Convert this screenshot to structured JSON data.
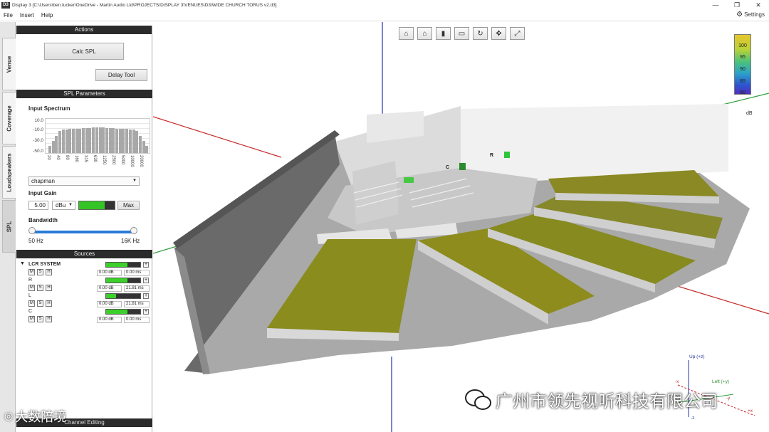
{
  "window": {
    "icon_label": "D3",
    "title": "Display 3 [C:\\Users\\ben.tucker\\OneDrive - Martin Audio Ltd\\PROJECTS\\DISPLAY 3\\VENUES\\D3\\WIDE CHURCH TORUS v2.d3]",
    "minimize": "—",
    "restore": "❐",
    "close": "✕"
  },
  "menu": {
    "file": "File",
    "insert": "Insert",
    "help": "Help",
    "settings": "Settings"
  },
  "tabs": {
    "venue": "Venue",
    "coverage": "Coverage",
    "loudspeakers": "Loudspeakers",
    "spl": "SPL"
  },
  "actions": {
    "header": "Actions",
    "calc_spl": "Calc SPL",
    "delay_tool": "Delay Tool"
  },
  "spl_params": {
    "header": "SPL Parameters",
    "input_spectrum_label": "Input Spectrum",
    "y_ticks": [
      "10.0",
      "-10.0",
      "-30.0",
      "-50.0"
    ],
    "x_ticks": [
      "20",
      "40",
      "80",
      "160",
      "315",
      "630",
      "1250",
      "2500",
      "5000",
      "10000",
      "20000"
    ],
    "spectrum_type": "chapman",
    "input_gain_label": "Input Gain",
    "gain_value": "5.00",
    "gain_unit": "dBu",
    "gain_level": 0.72,
    "max_label": "Max",
    "bandwidth_label": "Bandwidth",
    "bw_low": "50 Hz",
    "bw_high": "16K Hz"
  },
  "sources": {
    "header": "Sources",
    "items": [
      {
        "name": "LCR SYSTEM",
        "level": "0.00 dB",
        "delay": "0.00 ms",
        "meter": 0.62
      },
      {
        "name": "R",
        "level": "0.00 dB",
        "delay": "21.81 ms",
        "meter": 0.62
      },
      {
        "name": "L",
        "level": "0.00 dB",
        "delay": "21.81 ms",
        "meter": 0.3
      },
      {
        "name": "C",
        "level": "0.00 dB",
        "delay": "0.00 ms",
        "meter": 0.62
      }
    ],
    "m": "M",
    "s": "S",
    "h": "H",
    "footer": "Channel Editing"
  },
  "toolbar_icons": [
    "home-front-icon",
    "home-icon",
    "side-view-icon",
    "top-view-icon",
    "rotate-icon",
    "pan-icon",
    "fit-icon"
  ],
  "legend": {
    "values": [
      "100",
      "95",
      "90",
      "85",
      "80"
    ],
    "unit": "dB"
  },
  "speaker_labels": {
    "r": "R",
    "c": "C"
  },
  "axes": {
    "up": "Up (+z)",
    "left": "Left (+y)",
    "neg_z": "-z",
    "neg_x": "-x",
    "x_plus": "x",
    "neg_y": "-y",
    "pos_x": "+x"
  },
  "watermark": {
    "company": "广州市领先视听科技有限公司",
    "brand": "大数陪境"
  },
  "colors": {
    "accent": "#2a7bd8",
    "meter": "#35c425",
    "dark_header": "#2b2b2b",
    "audience": "#8a8c1e"
  }
}
